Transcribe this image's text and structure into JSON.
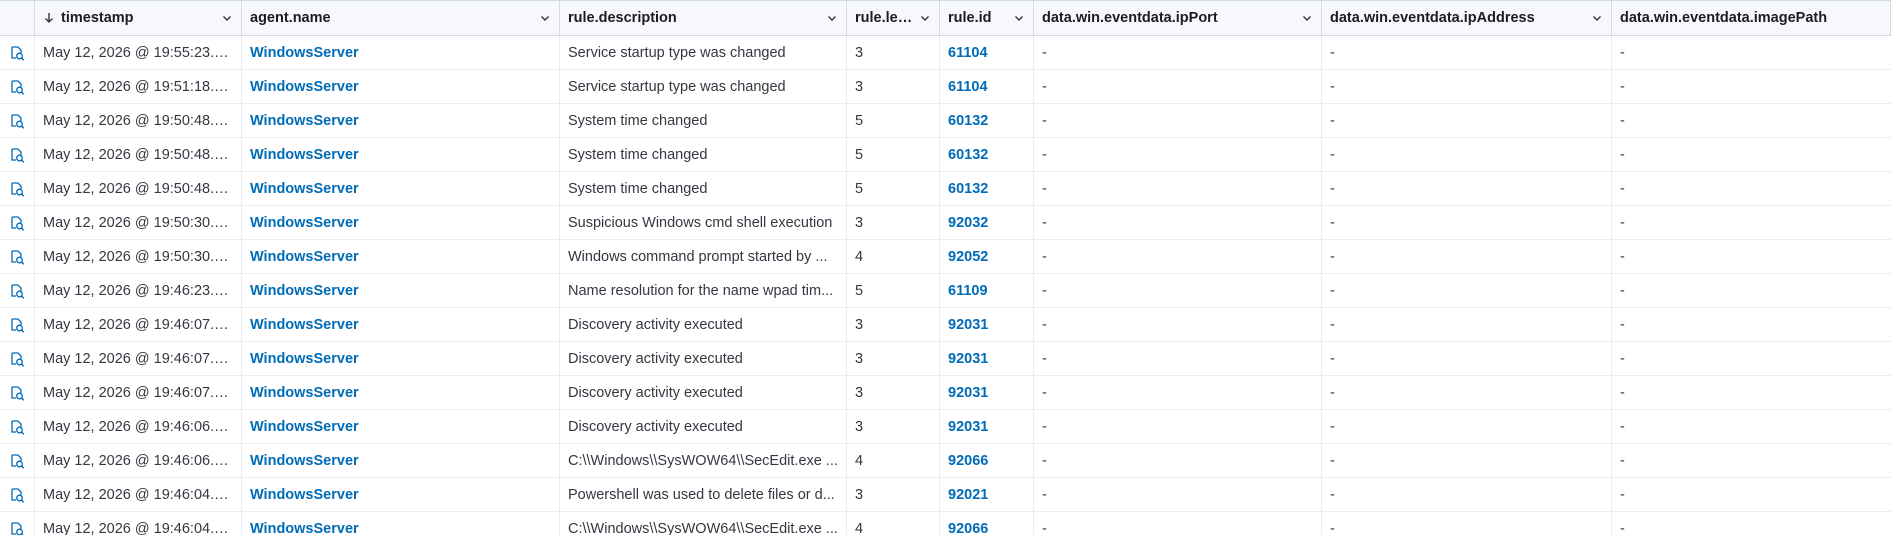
{
  "table": {
    "columns": [
      {
        "label": "timestamp",
        "sorted": "desc"
      },
      {
        "label": "agent.name"
      },
      {
        "label": "rule.description"
      },
      {
        "label": "rule.level"
      },
      {
        "label": "rule.id"
      },
      {
        "label": "data.win.eventdata.ipPort"
      },
      {
        "label": "data.win.eventdata.ipAddress"
      },
      {
        "label": "data.win.eventdata.imagePath"
      }
    ],
    "rows": [
      {
        "timestamp": "May 12, 2026 @ 19:55:23.5...",
        "agent": "WindowsServer",
        "description": "Service startup type was changed",
        "level": "3",
        "rule_id": "61104",
        "ipPort": "-",
        "ipAddress": "-",
        "imagePath": "-"
      },
      {
        "timestamp": "May 12, 2026 @ 19:51:18.6...",
        "agent": "WindowsServer",
        "description": "Service startup type was changed",
        "level": "3",
        "rule_id": "61104",
        "ipPort": "-",
        "ipAddress": "-",
        "imagePath": "-"
      },
      {
        "timestamp": "May 12, 2026 @ 19:50:48.3...",
        "agent": "WindowsServer",
        "description": "System time changed",
        "level": "5",
        "rule_id": "60132",
        "ipPort": "-",
        "ipAddress": "-",
        "imagePath": "-"
      },
      {
        "timestamp": "May 12, 2026 @ 19:50:48.3...",
        "agent": "WindowsServer",
        "description": "System time changed",
        "level": "5",
        "rule_id": "60132",
        "ipPort": "-",
        "ipAddress": "-",
        "imagePath": "-"
      },
      {
        "timestamp": "May 12, 2026 @ 19:50:48.2...",
        "agent": "WindowsServer",
        "description": "System time changed",
        "level": "5",
        "rule_id": "60132",
        "ipPort": "-",
        "ipAddress": "-",
        "imagePath": "-"
      },
      {
        "timestamp": "May 12, 2026 @ 19:50:30.3...",
        "agent": "WindowsServer",
        "description": "Suspicious Windows cmd shell execution",
        "level": "3",
        "rule_id": "92032",
        "ipPort": "-",
        "ipAddress": "-",
        "imagePath": "-"
      },
      {
        "timestamp": "May 12, 2026 @ 19:50:30.3...",
        "agent": "WindowsServer",
        "description": "Windows command prompt started by ...",
        "level": "4",
        "rule_id": "92052",
        "ipPort": "-",
        "ipAddress": "-",
        "imagePath": "-"
      },
      {
        "timestamp": "May 12, 2026 @ 19:46:23.5...",
        "agent": "WindowsServer",
        "description": "Name resolution for the name wpad tim...",
        "level": "5",
        "rule_id": "61109",
        "ipPort": "-",
        "ipAddress": "-",
        "imagePath": "-"
      },
      {
        "timestamp": "May 12, 2026 @ 19:46:07.5...",
        "agent": "WindowsServer",
        "description": "Discovery activity executed",
        "level": "3",
        "rule_id": "92031",
        "ipPort": "-",
        "ipAddress": "-",
        "imagePath": "-"
      },
      {
        "timestamp": "May 12, 2026 @ 19:46:07.5...",
        "agent": "WindowsServer",
        "description": "Discovery activity executed",
        "level": "3",
        "rule_id": "92031",
        "ipPort": "-",
        "ipAddress": "-",
        "imagePath": "-"
      },
      {
        "timestamp": "May 12, 2026 @ 19:46:07.4...",
        "agent": "WindowsServer",
        "description": "Discovery activity executed",
        "level": "3",
        "rule_id": "92031",
        "ipPort": "-",
        "ipAddress": "-",
        "imagePath": "-"
      },
      {
        "timestamp": "May 12, 2026 @ 19:46:06.5...",
        "agent": "WindowsServer",
        "description": "Discovery activity executed",
        "level": "3",
        "rule_id": "92031",
        "ipPort": "-",
        "ipAddress": "-",
        "imagePath": "-"
      },
      {
        "timestamp": "May 12, 2026 @ 19:46:06.4...",
        "agent": "WindowsServer",
        "description": "C:\\\\Windows\\\\SysWOW64\\\\SecEdit.exe ...",
        "level": "4",
        "rule_id": "92066",
        "ipPort": "-",
        "ipAddress": "-",
        "imagePath": "-"
      },
      {
        "timestamp": "May 12, 2026 @ 19:46:04.9...",
        "agent": "WindowsServer",
        "description": "Powershell was used to delete files or d...",
        "level": "3",
        "rule_id": "92021",
        "ipPort": "-",
        "ipAddress": "-",
        "imagePath": "-"
      },
      {
        "timestamp": "May 12, 2026 @ 19:46:04.8...",
        "agent": "WindowsServer",
        "description": "C:\\\\Windows\\\\SysWOW64\\\\SecEdit.exe ...",
        "level": "4",
        "rule_id": "92066",
        "ipPort": "-",
        "ipAddress": "-",
        "imagePath": "-"
      }
    ]
  },
  "colors": {
    "link": "#006bb8",
    "header_bg": "#f7f8fc",
    "border": "#e9ecf1",
    "icon": "#006bb8"
  },
  "icons": {
    "sort": "arrow-down-icon",
    "column_menu": "chevron-down-icon",
    "row_action": "inspect-document-icon"
  }
}
